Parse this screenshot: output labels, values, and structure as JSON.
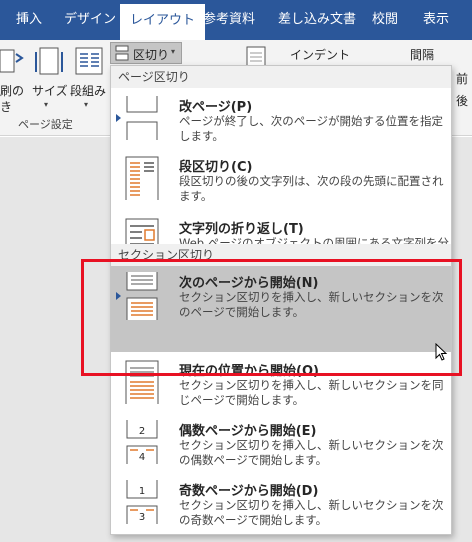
{
  "tabs": [
    {
      "label": "挿入",
      "active": false
    },
    {
      "label": "デザイン",
      "active": false
    },
    {
      "label": "レイアウト",
      "active": true
    },
    {
      "label": "参考資料",
      "active": false
    },
    {
      "label": "差し込み文書",
      "active": false
    },
    {
      "label": "校閲",
      "active": false
    },
    {
      "label": "表示",
      "active": false
    }
  ],
  "ribbon": {
    "breaks_button": "区切り",
    "margins_partial": "刷の",
    "margins_partial2": "き",
    "size_label": "サイズ",
    "columns_label": "段組み",
    "group_page_setup": "ページ設定",
    "indent_label": "インデント",
    "spacing_label": "間隔",
    "before_partial": "前",
    "after_partial": "後"
  },
  "menu": {
    "section1_header": "ページ区切り",
    "section2_header": "セクション区切り",
    "items": [
      {
        "title": "改ページ(P)",
        "desc": "ページが終了し、次のページが開始する位置を指定します。",
        "icon": "page-break-icon"
      },
      {
        "title": "段区切り(C)",
        "desc": "段区切りの後の文字列は、次の段の先頭に配置されます。",
        "icon": "column-break-icon"
      },
      {
        "title": "文字列の折り返し(T)",
        "desc": "Web ページのオブジェクトの周囲にある文字列を分離します (本文とオブジェクトの説明文を分離する場合など)。",
        "icon": "text-wrapping-break-icon"
      },
      {
        "title": "次のページから開始(N)",
        "desc": "セクション区切りを挿入し、新しいセクションを次のページで開始します。",
        "icon": "next-page-section-icon"
      },
      {
        "title": "現在の位置から開始(O)",
        "desc": "セクション区切りを挿入し、新しいセクションを同じページで開始します。",
        "icon": "continuous-section-icon"
      },
      {
        "title": "偶数ページから開始(E)",
        "desc": "セクション区切りを挿入し、新しいセクションを次の偶数ページで開始します。",
        "icon": "even-page-section-icon"
      },
      {
        "title": "奇数ページから開始(D)",
        "desc": "セクション区切りを挿入し、新しいセクションを次の奇数ページで開始します。",
        "icon": "odd-page-section-icon"
      }
    ]
  },
  "colors": {
    "ribbon_blue": "#2b579a",
    "highlight": "#c5c5c5",
    "annotation_red": "#e81123",
    "icon_orange": "#e07a2e"
  }
}
